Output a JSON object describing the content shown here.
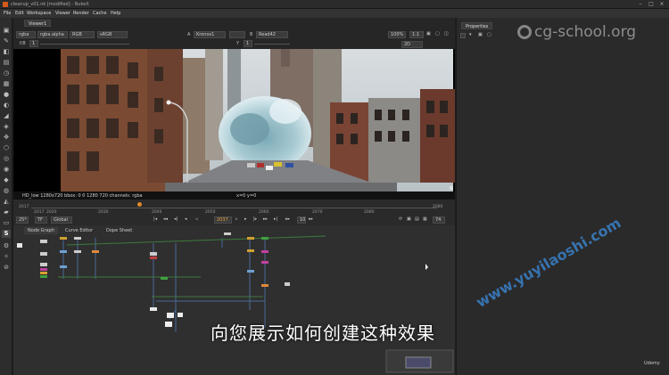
{
  "window": {
    "title": "cleanup_v01.nk [modified] - NukeX"
  },
  "menu": [
    "File",
    "Edit",
    "Workspace",
    "Viewer",
    "Render",
    "Cache",
    "Help"
  ],
  "viewer": {
    "tab": "Viewer1",
    "channels": "rgba",
    "alpha": "rgba.alpha",
    "colorspace_a": "RGB",
    "colorspace_b": "sRGB",
    "input_a": "A",
    "input_a_node": "Kronos1",
    "input_b": "B",
    "input_b_node": "Read42",
    "zoom": "100%",
    "ratio": "1:1",
    "mode": "2D",
    "gain_label": "f/8",
    "gain_value": "1",
    "gamma_label": "Y",
    "gamma_value": "1",
    "format_info": "HD_low 1280x720  bbox: 0 0 1280 720 channels: rgba",
    "coords": "x=0 y=0"
  },
  "timeline": {
    "start": "2017",
    "end": "2080",
    "labels": [
      "2017",
      "2020",
      "2030",
      "2040",
      "2050",
      "2060",
      "2070",
      "2080"
    ],
    "current_frame": "2037",
    "fps": "25*",
    "tf": "TF",
    "global": "Global",
    "step": "10",
    "end_field": "74"
  },
  "node_graph": {
    "tabs": [
      "Node Graph",
      "Curve Editor",
      "Dope Sheet"
    ]
  },
  "properties": {
    "tab": "Properties"
  },
  "subtitle": "向您展示如何创建这种效果",
  "watermark_top": "cg-school.org",
  "watermark_diag": "www.yuyilaoshi.com",
  "udemy": "Udemy"
}
